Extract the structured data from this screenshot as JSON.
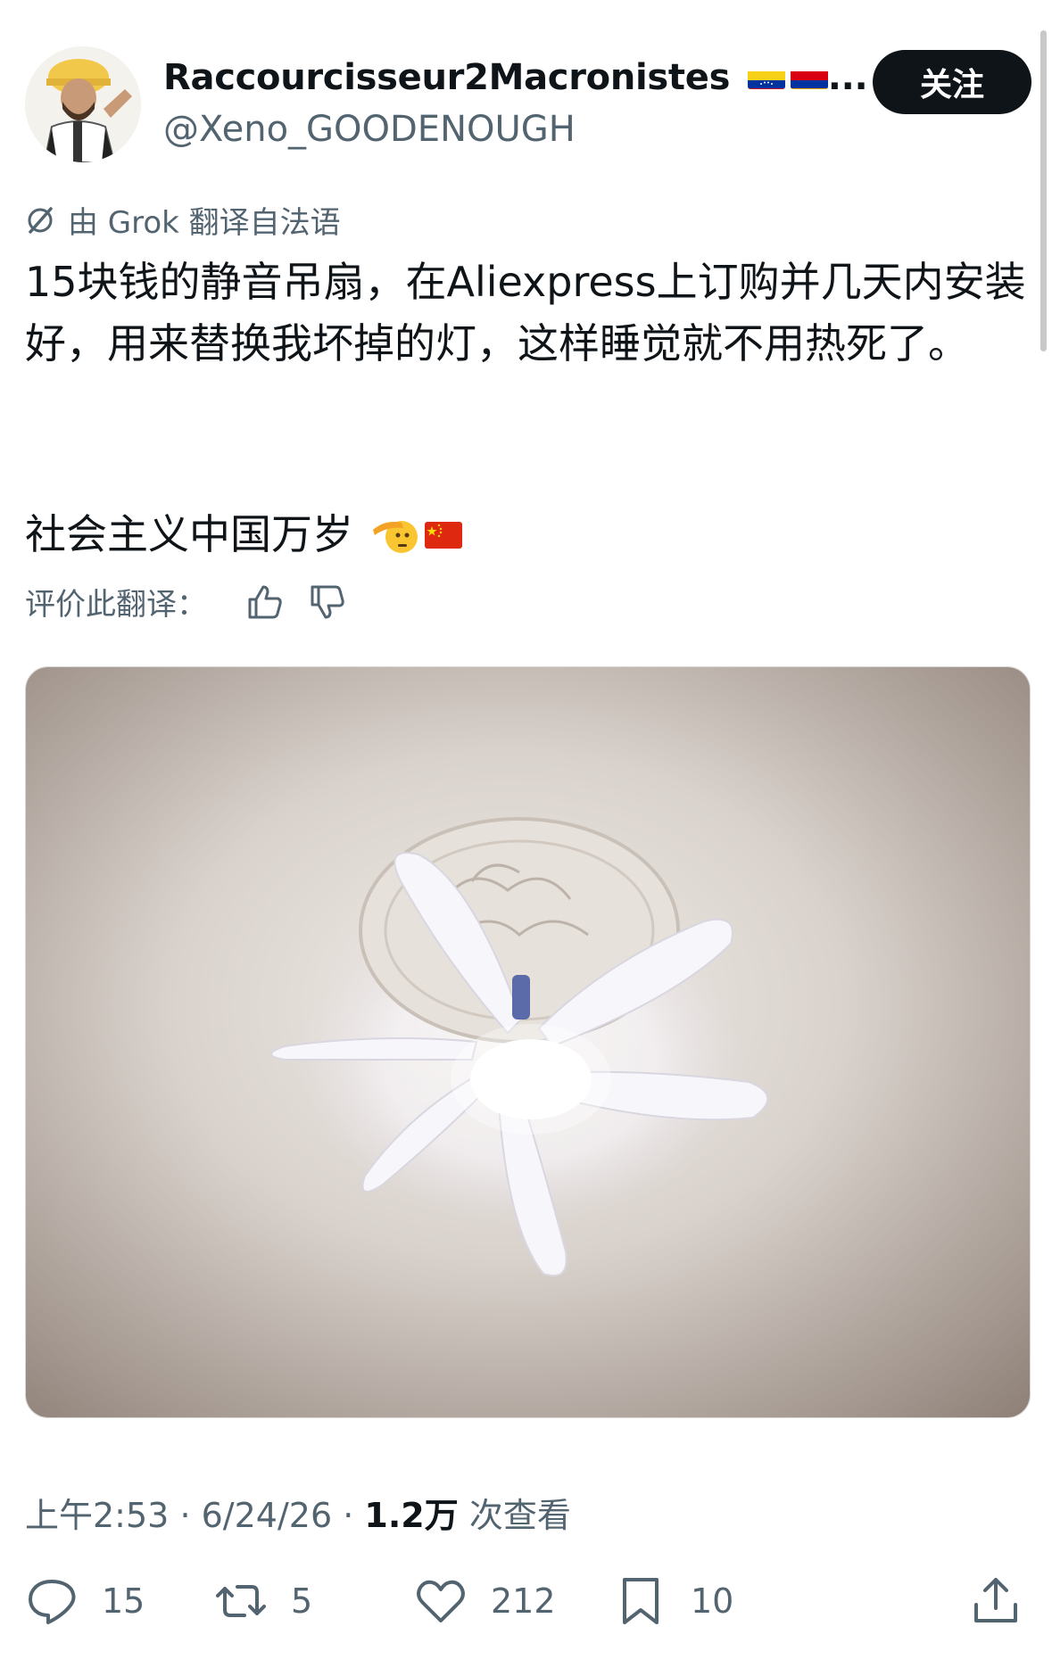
{
  "author": {
    "display_name": "Raccourcisseur2Macronistes",
    "name_suffix": "...",
    "handle": "@Xeno_GOODENOUGH",
    "follow_label": "关注"
  },
  "translation": {
    "notice": "由 Grok 翻译自法语",
    "rate_label": "评价此翻译："
  },
  "post": {
    "text": "15块钱的静音吊扇，在Aliexpress上订购并几天内安装好，用来替换我坏掉的灯，这样睡觉就不用热死了。",
    "tagline": "社会主义中国万岁"
  },
  "meta": {
    "time": "上午2:53",
    "separator": "·",
    "date": "6/24/26",
    "views": "1.2万",
    "views_label": "次查看"
  },
  "actions": {
    "replies": "15",
    "reposts": "5",
    "likes": "212",
    "bookmarks": "10"
  },
  "icons": [
    "grok-translate-icon",
    "thumbs-up-icon",
    "thumbs-down-icon",
    "reply-icon",
    "repost-icon",
    "like-icon",
    "bookmark-icon",
    "share-icon"
  ],
  "colors": {
    "text": "#0f1419",
    "secondary": "#536471",
    "button": "#0f1419"
  }
}
